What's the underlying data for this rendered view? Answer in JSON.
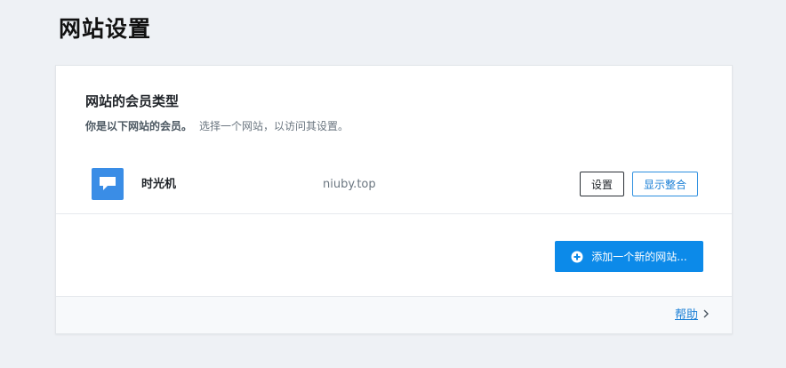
{
  "page": {
    "title": "网站设置"
  },
  "membership": {
    "title": "网站的会员类型",
    "subtitle_strong": "你是以下网站的会员。",
    "subtitle_rest": "选择一个网站，以访问其设置。"
  },
  "site": {
    "icon": "chat-bubble-icon",
    "name": "时光机",
    "domain": "niuby.top",
    "settings_label": "设置",
    "integration_label": "显示整合"
  },
  "actions": {
    "add_site_label": "添加一个新的网站..."
  },
  "footer": {
    "help_label": "帮助"
  },
  "colors": {
    "accent": "#0c8ae9",
    "site_icon_bg": "#3a8de6",
    "background": "#eef1f5"
  }
}
